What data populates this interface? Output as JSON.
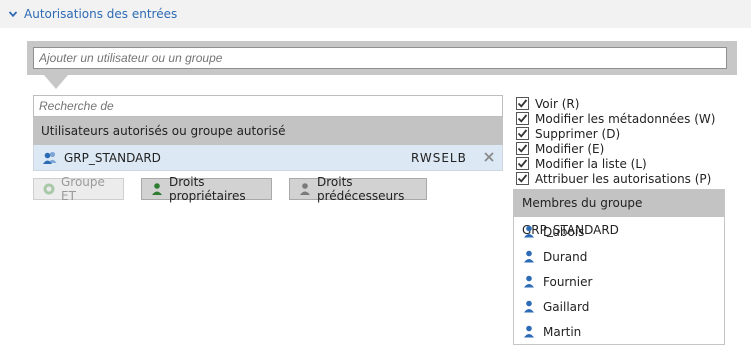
{
  "section": {
    "title": "Autorisations des entrées",
    "expanded_icon": "chevron-down-icon"
  },
  "add_field": {
    "placeholder": "Ajouter un utilisateur ou un groupe"
  },
  "search": {
    "placeholder": "Recherche de"
  },
  "users_table": {
    "header": "Utilisateurs autorisés ou groupe autorisé",
    "rows": [
      {
        "icon": "group-icon",
        "name": "GRP_STANDARD",
        "rights": "RWSELB"
      }
    ]
  },
  "buttons": {
    "group_et": "Groupe ET",
    "owner_rights": "Droits propriétaires",
    "predecessor_rights": "Droits prédécesseurs"
  },
  "permissions": [
    {
      "label": "Voir (R)",
      "checked": true
    },
    {
      "label": "Modifier les métadonnées (W)",
      "checked": true
    },
    {
      "label": "Supprimer (D)",
      "checked": true
    },
    {
      "label": "Modifier (E)",
      "checked": true
    },
    {
      "label": "Modifier la liste (L)",
      "checked": true
    },
    {
      "label": "Attribuer les autorisations (P)",
      "checked": true
    }
  ],
  "members_panel": {
    "header": "Membres du groupe GRP_STANDARD",
    "members": [
      "Dubois",
      "Durand",
      "Fournier",
      "Gaillard",
      "Martin"
    ]
  },
  "colors": {
    "accent": "#2d6bb5",
    "selected_row": "#dde8f5",
    "header_bg": "#c3c3c3",
    "user_icon": "#2d6bb5",
    "owner_icon": "#2e7d32"
  }
}
